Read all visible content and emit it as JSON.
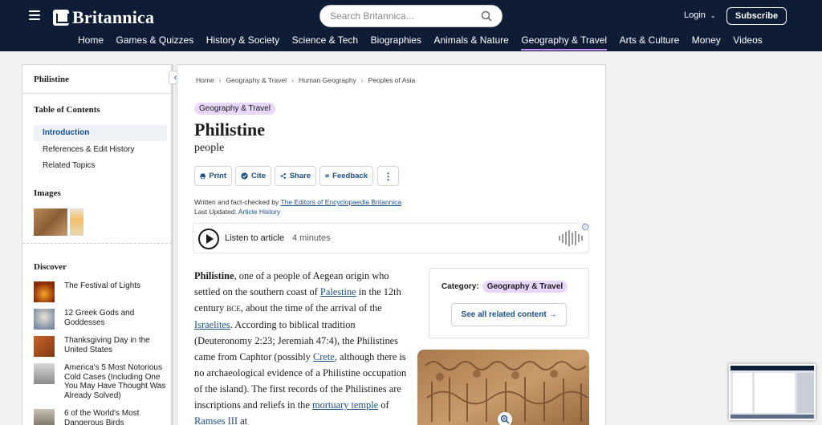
{
  "header": {
    "logo_text": "Britannica",
    "search_placeholder": "Search Britannica...",
    "login_label": "Login",
    "subscribe_label": "Subscribe",
    "nav": [
      "Home",
      "Games & Quizzes",
      "History & Society",
      "Science & Tech",
      "Biographies",
      "Animals & Nature",
      "Geography & Travel",
      "Arts & Culture",
      "Money",
      "Videos"
    ],
    "active_nav": "Geography & Travel"
  },
  "sidebar": {
    "title": "Philistine",
    "toc_heading": "Table of Contents",
    "toc": [
      "Introduction",
      "References & Edit History",
      "Related Topics"
    ],
    "images_heading": "Images",
    "discover_heading": "Discover",
    "discover": [
      "The Festival of Lights",
      "12 Greek Gods and Goddesses",
      "Thanksgiving Day in the United States",
      "America's 5 Most Notorious Cold Cases (Including One You May Have Thought Was Already Solved)",
      "6 of the World's Most Dangerous Birds"
    ]
  },
  "article": {
    "breadcrumbs": [
      "Home",
      "Geography & Travel",
      "Human Geography",
      "Peoples of Asia"
    ],
    "category_pill": "Geography & Travel",
    "title": "Philistine",
    "subtitle": "people",
    "actions": [
      "Print",
      "Cite",
      "Share",
      "Feedback"
    ],
    "written_by_prefix": "Written and fact-checked by",
    "written_by": "The Editors of Encyclopaedia Britannica",
    "updated_prefix": "Last Updated:",
    "updated_link": "Article History",
    "listen_label": "Listen to article",
    "listen_time": "4 minutes",
    "body": {
      "t1": "Philistine",
      "t2": ", one of a people of Aegean origin who settled on the southern coast of ",
      "l1": "Palestine",
      "t3": " in the 12th century ",
      "bce": "BCE",
      "t4": ", about the time of the arrival of the ",
      "l2": "Israelites",
      "t5": ". According to biblical tradition (Deuteronomy 2:23; Jeremiah 47:4), the Philistines came from Caphtor (possibly ",
      "l3": "Crete",
      "t6": ", although there is no archaeological evidence of a Philistine occupation of the island). The first records of the Philistines are inscriptions and reliefs in the ",
      "l4": "mortuary temple",
      "t7": " of ",
      "l5": "Ramses III",
      "t8": " at"
    },
    "category_label": "Category:",
    "category_value": "Geography & Travel",
    "see_all": "See all related content →"
  },
  "colors": {
    "header_bg": "#0e1c36",
    "pill_bg": "#e9d7fb",
    "link": "#1b4f8a",
    "active_underline": "#c38ff0"
  }
}
